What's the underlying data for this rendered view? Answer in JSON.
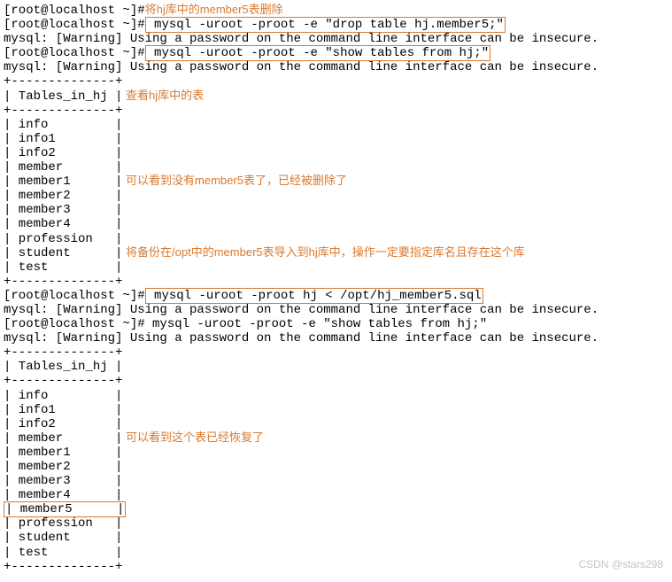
{
  "lines": {
    "l1_prompt": "[root@localhost ~]#",
    "l1_anno": "将hj库中的member5表删除",
    "l2_prompt": "[root@localhost ~]#",
    "l2_cmd": " mysql -uroot -proot -e \"drop table hj.member5;\"",
    "l3_warn": "mysql: [Warning] Using a password on the command line interface can be insecure.",
    "l4_prompt": "[root@localhost ~]#",
    "l4_cmd": " mysql -uroot -proot -e \"show tables from hj;\"",
    "l5_warn": "mysql: [Warning] Using a password on the command line interface can be insecure.",
    "sep": "+--------------+",
    "hdr": "| Tables_in_hj |",
    "hdr_anno": "   查看hj库中的表",
    "rows1": [
      "| info         |",
      "| info1        |",
      "| info2        |",
      "| member       |",
      "| member1      |",
      "| member2      |",
      "| member3      |",
      "| member4      |",
      "| profession   |",
      "| student      |",
      "| test         |"
    ],
    "rows1_anno_delete": "可以看到没有member5表了，已经被删除了",
    "rows1_anno_import": "将备份在/opt中的member5表导入到hj库中，操作一定要指定库名且存在这个库",
    "imp_prompt": "[root@localhost ~]#",
    "imp_cmd": " mysql -uroot -proot hj < /opt/hj_member5.sql",
    "imp_warn": "mysql: [Warning] Using a password on the command line interface can be insecure.",
    "show2_prompt": "[root@localhost ~]# mysql -uroot -proot -e \"show tables from hj;\"",
    "show2_warn": "mysql: [Warning] Using a password on the command line interface can be insecure.",
    "rows2": [
      "| info         |",
      "| info1        |",
      "| info2        |",
      "| member       |",
      "| member1      |",
      "| member2      |",
      "| member3      |",
      "| member4      |"
    ],
    "rows2_member5": "| member5      |",
    "rows2_after": [
      "| profession   |",
      "| student      |",
      "| test         |"
    ],
    "rows2_anno_restore": "可以看到这个表已经恢复了",
    "watermark": "CSDN @stars298"
  }
}
